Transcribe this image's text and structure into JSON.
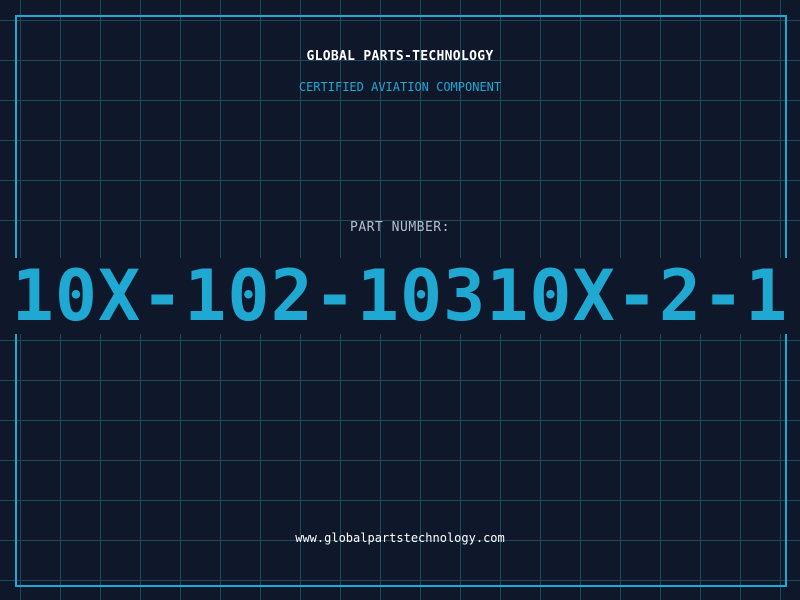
{
  "header": {
    "company": "GLOBAL PARTS-TECHNOLOGY",
    "subtitle": "CERTIFIED AVIATION COMPONENT"
  },
  "part": {
    "label": "PART NUMBER:",
    "number": "10X-102-10310X-2-1"
  },
  "footer": {
    "website": "www.globalpartstechnology.com"
  },
  "colors": {
    "background": "#0f172a",
    "grid": "#1d4b5e",
    "accent": "#1fa8d1",
    "text": "#ffffff",
    "muted": "#b6c0cc"
  }
}
